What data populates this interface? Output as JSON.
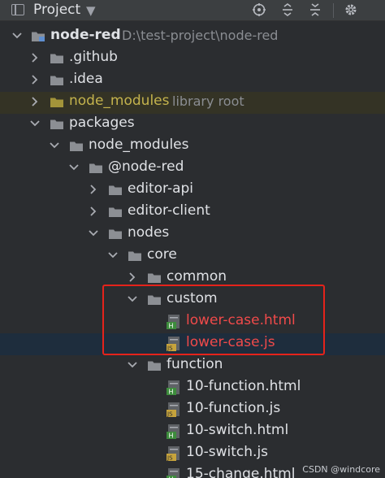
{
  "toolbar": {
    "title": "Project",
    "icons": [
      "view-mode-icon",
      "dropdown-caret-icon",
      "locate-icon",
      "expand-all-icon",
      "collapse-all-icon",
      "settings-icon"
    ],
    "colors": {
      "background": "#3c3f41",
      "icon": "#9da0a8"
    }
  },
  "tree": {
    "root": {
      "name": "node-red",
      "path": "D:\\test-project\\node-red"
    },
    "github": ".github",
    "idea": ".idea",
    "node_modules_root": {
      "name": "node_modules",
      "suffix": "library root"
    },
    "packages": "packages",
    "node_modules": "node_modules",
    "scope": "@node-red",
    "editor_api": "editor-api",
    "editor_client": "editor-client",
    "nodes": "nodes",
    "core": "core",
    "common": "common",
    "custom": "custom",
    "lower_case_html": "lower-case.html",
    "lower_case_js": "lower-case.js",
    "function": "function",
    "f_10_function_html": "10-function.html",
    "f_10_function_js": "10-function.js",
    "f_10_switch_html": "10-switch.html",
    "f_10_switch_js": "10-switch.js",
    "f_15_change_html": "15-change.html"
  },
  "colors": {
    "background": "#2b2d30",
    "folder": "#8c8f94",
    "library_root_text": "#c4b34d",
    "library_root_row": "#343325",
    "selected_row": "#1e2d3d",
    "highlight_text": "#f04a4a",
    "highlight_box": "#e5231b",
    "html_badge": "#3d8c3c",
    "js_badge": "#c6a33c"
  },
  "watermark": "CSDN @windcore"
}
